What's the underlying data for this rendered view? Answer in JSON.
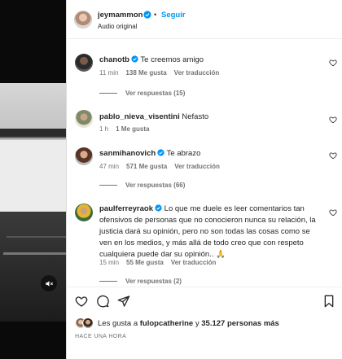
{
  "post": {
    "username": "jeymammon",
    "follow_label": "Seguir",
    "separator": "•",
    "audio_label": "Audio original"
  },
  "comments": [
    {
      "username": "chanotb",
      "text": "Te creemos amigo",
      "time": "11 min",
      "likes": "138 Me gusta",
      "translate": "Ver traducción",
      "replies": "Ver respuestas (15)"
    },
    {
      "username": "pablo_nieva_visentini",
      "text": "Nefasto",
      "time": "1 h",
      "likes": "1 Me gusta",
      "translate": "",
      "replies": ""
    },
    {
      "username": "sanmihanovich",
      "text": "Te abrazo",
      "time": "47 min",
      "likes": "571 Me gusta",
      "translate": "Ver traducción",
      "replies": "Ver respuestas (66)"
    },
    {
      "username": "paulferreyraok",
      "text": "Lo que me duele es leer comentarios tan ofensivos de personas que no conocieron nunca su relación, la justicia dará su opinión, pero no son todas las cosas como se ven en los medios, y más allá de todo creo que con respeto cualquiera puede dar su opinión..",
      "emoji": "🙏",
      "time": "15 min",
      "likes": "55 Me gusta",
      "translate": "Ver traducción",
      "replies": "Ver respuestas (2)"
    }
  ],
  "footer": {
    "likes_prefix": "Les gusta a",
    "likes_user": "fulopcatherine",
    "likes_connector": "y",
    "likes_count": "35.127 personas más",
    "time_ago": "HACE UNA HORA"
  },
  "colors": {
    "accent": "#0095f6",
    "text": "#262626",
    "muted": "#737373"
  },
  "icons": [
    "mute-icon",
    "verified-icon",
    "heart-icon",
    "comment-icon",
    "share-icon",
    "bookmark-icon"
  ]
}
